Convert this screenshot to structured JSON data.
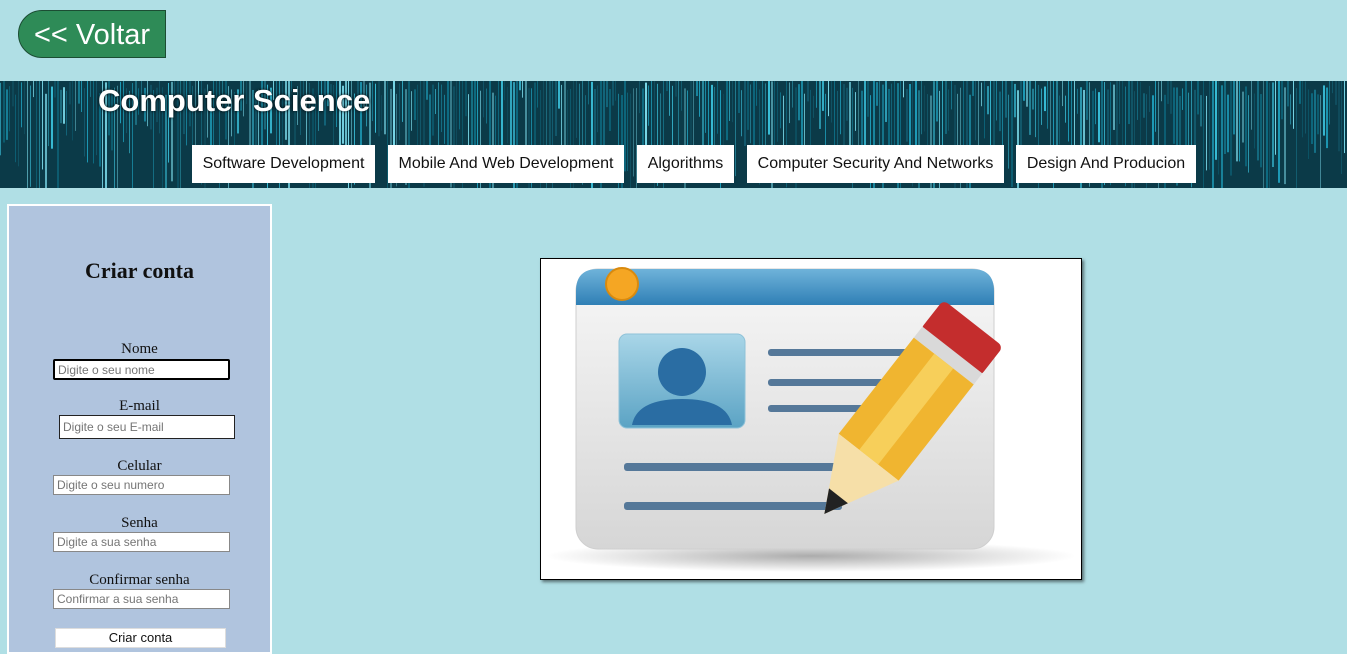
{
  "back_button": {
    "label": "<< Voltar"
  },
  "header": {
    "title": "Computer Science",
    "nav": [
      {
        "label": "Software Development"
      },
      {
        "label": "Mobile And Web Development"
      },
      {
        "label": "Algorithms"
      },
      {
        "label": "Computer Security And Networks"
      },
      {
        "label": "Design And Producion"
      }
    ]
  },
  "form": {
    "title": "Criar conta",
    "fields": [
      {
        "label": "Nome",
        "placeholder": "Digite o seu nome",
        "value": ""
      },
      {
        "label": "E-mail",
        "placeholder": "Digite o seu E-mail",
        "value": ""
      },
      {
        "label": "Celular",
        "placeholder": "Digite o seu numero",
        "value": ""
      },
      {
        "label": "Senha",
        "placeholder": "Digite a sua senha",
        "value": ""
      },
      {
        "label": "Confirmar senha",
        "placeholder": "Confirmar a sua senha",
        "value": ""
      }
    ],
    "submit_label": "Criar conta"
  },
  "illustration": {
    "icon": "id-card-edit-icon"
  },
  "colors": {
    "page_background": "#b0dfe5",
    "panel_background": "#b0c4de",
    "back_button": "#2e8b57",
    "banner": "#0b3a48"
  }
}
